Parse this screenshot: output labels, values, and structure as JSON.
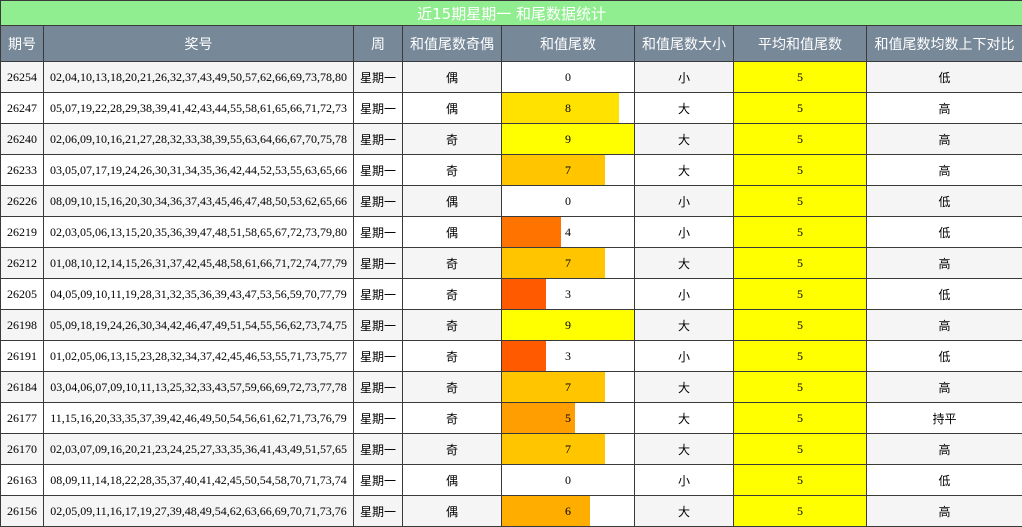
{
  "title": "近15期星期一 和尾数据统计",
  "headers": [
    "期号",
    "奖号",
    "周",
    "和值尾数奇偶",
    "和值尾数",
    "和值尾数大小",
    "平均和值尾数",
    "和值尾数均数上下对比"
  ],
  "colors": {
    "title_bg": "#90ee90",
    "header_bg": "#778899",
    "avg_bg": "#ffff00",
    "bar_by_value": {
      "3": "#ff5a00",
      "4": "#ff7300",
      "5": "#ff9e00",
      "6": "#ffae00",
      "7": "#ffc600",
      "8": "#ffe200",
      "9": "#ffff00"
    }
  },
  "max_tail": 9,
  "rows": [
    {
      "issue": "26254",
      "numbers": "02,04,10,13,18,20,21,26,32,37,43,49,50,57,62,66,69,73,78,80",
      "week": "星期一",
      "parity": "偶",
      "tail": 0,
      "tail_label": "0",
      "size": "小",
      "avg": "5",
      "compare": "低"
    },
    {
      "issue": "26247",
      "numbers": "05,07,19,22,28,29,38,39,41,42,43,44,55,58,61,65,66,71,72,73",
      "week": "星期一",
      "parity": "偶",
      "tail": 8,
      "tail_label": "8",
      "size": "大",
      "avg": "5",
      "compare": "高"
    },
    {
      "issue": "26240",
      "numbers": "02,06,09,10,16,21,27,28,32,33,38,39,55,63,64,66,67,70,75,78",
      "week": "星期一",
      "parity": "奇",
      "tail": 9,
      "tail_label": "9",
      "size": "大",
      "avg": "5",
      "compare": "高"
    },
    {
      "issue": "26233",
      "numbers": "03,05,07,17,19,24,26,30,31,34,35,36,42,44,52,53,55,63,65,66",
      "week": "星期一",
      "parity": "奇",
      "tail": 7,
      "tail_label": "7",
      "size": "大",
      "avg": "5",
      "compare": "高"
    },
    {
      "issue": "26226",
      "numbers": "08,09,10,15,16,20,30,34,36,37,43,45,46,47,48,50,53,62,65,66",
      "week": "星期一",
      "parity": "偶",
      "tail": 0,
      "tail_label": "0",
      "size": "小",
      "avg": "5",
      "compare": "低"
    },
    {
      "issue": "26219",
      "numbers": "02,03,05,06,13,15,20,35,36,39,47,48,51,58,65,67,72,73,79,80",
      "week": "星期一",
      "parity": "偶",
      "tail": 4,
      "tail_label": "4",
      "size": "小",
      "avg": "5",
      "compare": "低"
    },
    {
      "issue": "26212",
      "numbers": "01,08,10,12,14,15,26,31,37,42,45,48,58,61,66,71,72,74,77,79",
      "week": "星期一",
      "parity": "奇",
      "tail": 7,
      "tail_label": "7",
      "size": "大",
      "avg": "5",
      "compare": "高"
    },
    {
      "issue": "26205",
      "numbers": "04,05,09,10,11,19,28,31,32,35,36,39,43,47,53,56,59,70,77,79",
      "week": "星期一",
      "parity": "奇",
      "tail": 3,
      "tail_label": "3",
      "size": "小",
      "avg": "5",
      "compare": "低"
    },
    {
      "issue": "26198",
      "numbers": "05,09,18,19,24,26,30,34,42,46,47,49,51,54,55,56,62,73,74,75",
      "week": "星期一",
      "parity": "奇",
      "tail": 9,
      "tail_label": "9",
      "size": "大",
      "avg": "5",
      "compare": "高"
    },
    {
      "issue": "26191",
      "numbers": "01,02,05,06,13,15,23,28,32,34,37,42,45,46,53,55,71,73,75,77",
      "week": "星期一",
      "parity": "奇",
      "tail": 3,
      "tail_label": "3",
      "size": "小",
      "avg": "5",
      "compare": "低"
    },
    {
      "issue": "26184",
      "numbers": "03,04,06,07,09,10,11,13,25,32,33,43,57,59,66,69,72,73,77,78",
      "week": "星期一",
      "parity": "奇",
      "tail": 7,
      "tail_label": "7",
      "size": "大",
      "avg": "5",
      "compare": "高"
    },
    {
      "issue": "26177",
      "numbers": "11,15,16,20,33,35,37,39,42,46,49,50,54,56,61,62,71,73,76,79",
      "week": "星期一",
      "parity": "奇",
      "tail": 5,
      "tail_label": "5",
      "size": "大",
      "avg": "5",
      "compare": "持平"
    },
    {
      "issue": "26170",
      "numbers": "02,03,07,09,16,20,21,23,24,25,27,33,35,36,41,43,49,51,57,65",
      "week": "星期一",
      "parity": "奇",
      "tail": 7,
      "tail_label": "7",
      "size": "大",
      "avg": "5",
      "compare": "高"
    },
    {
      "issue": "26163",
      "numbers": "08,09,11,14,18,22,28,35,37,40,41,42,45,50,54,58,70,71,73,74",
      "week": "星期一",
      "parity": "偶",
      "tail": 0,
      "tail_label": "0",
      "size": "小",
      "avg": "5",
      "compare": "低"
    },
    {
      "issue": "26156",
      "numbers": "02,05,09,11,16,17,19,27,39,48,49,54,62,63,66,69,70,71,73,76",
      "week": "星期一",
      "parity": "偶",
      "tail": 6,
      "tail_label": "6",
      "size": "大",
      "avg": "5",
      "compare": "高"
    }
  ]
}
